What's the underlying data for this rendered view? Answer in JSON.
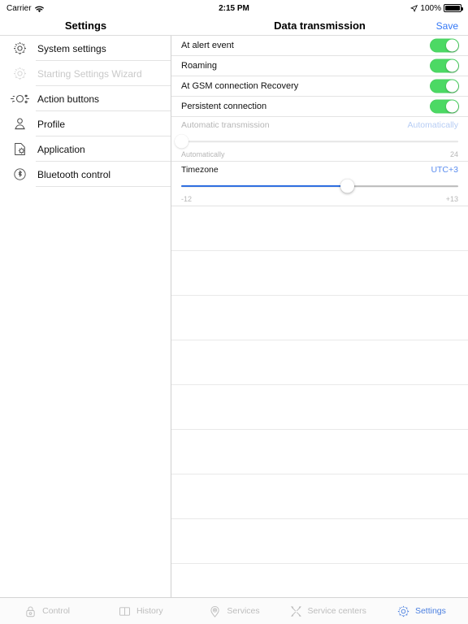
{
  "statusbar": {
    "carrier": "Carrier",
    "wifi_icon": "wifi-icon",
    "time": "2:15 PM",
    "location_icon": "location-arrow-icon",
    "battery_percent": "100%",
    "battery_icon": "battery-full-icon"
  },
  "sidebar": {
    "title": "Settings",
    "items": [
      {
        "label": "System settings",
        "icon": "gear-icon",
        "disabled": false
      },
      {
        "label": "Starting Settings Wizard",
        "icon": "gear-icon",
        "disabled": true
      },
      {
        "label": "Action buttons",
        "icon": "action-buttons-icon",
        "disabled": false
      },
      {
        "label": "Profile",
        "icon": "person-icon",
        "disabled": false
      },
      {
        "label": "Application",
        "icon": "app-gear-icon",
        "disabled": false
      },
      {
        "label": "Bluetooth control",
        "icon": "bluetooth-icon",
        "disabled": false
      }
    ]
  },
  "detail": {
    "title": "Data transmission",
    "save_label": "Save",
    "toggles": [
      {
        "label": "At alert event",
        "on": true
      },
      {
        "label": "Roaming",
        "on": true
      },
      {
        "label": "At GSM connection Recovery",
        "on": true
      },
      {
        "label": "Persistent connection",
        "on": true
      }
    ],
    "sliders": [
      {
        "title": "Automatic transmission",
        "value_label": "Automatically",
        "min_label": "Automatically",
        "max_label": "24",
        "percent": 0,
        "disabled": true
      },
      {
        "title": "Timezone",
        "value_label": "UTC+3",
        "min_label": "-12",
        "max_label": "+13",
        "percent": 60,
        "disabled": false
      }
    ],
    "empty_row_count": 9
  },
  "tabbar": {
    "tabs": [
      {
        "label": "Control",
        "icon": "lock-icon",
        "active": false
      },
      {
        "label": "History",
        "icon": "book-icon",
        "active": false
      },
      {
        "label": "Services",
        "icon": "map-pin-icon",
        "active": false
      },
      {
        "label": "Service centers",
        "icon": "wrench-screwdriver-icon",
        "active": false
      },
      {
        "label": "Settings",
        "icon": "gear-icon",
        "active": true
      }
    ]
  },
  "colors": {
    "accent": "#3478f6",
    "toggle_on": "#4cd964",
    "slider_fill": "#2f6fe0",
    "muted": "#b6b6b6"
  }
}
